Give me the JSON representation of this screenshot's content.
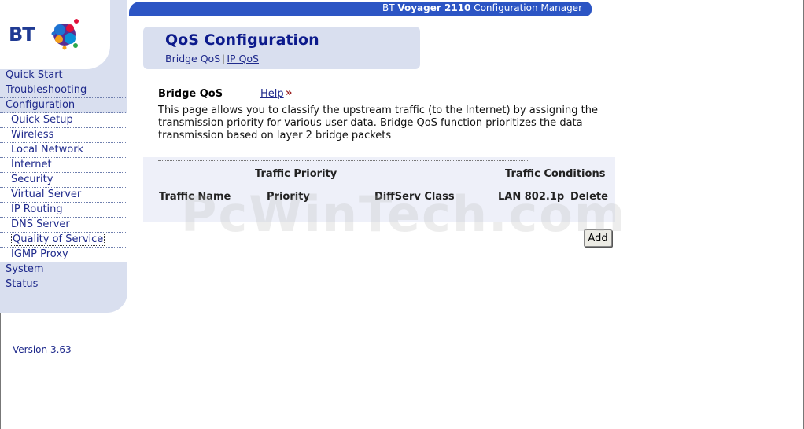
{
  "header": {
    "title_prefix": "BT ",
    "title_bold": "Voyager 2110",
    "title_suffix": " Configuration Manager"
  },
  "logo": {
    "text": "BT"
  },
  "sidebar": {
    "items": [
      {
        "label": "Quick Start",
        "level": "top"
      },
      {
        "label": "Troubleshooting",
        "level": "top"
      },
      {
        "label": "Configuration",
        "level": "top"
      },
      {
        "label": "Quick Setup",
        "level": "sub"
      },
      {
        "label": "Wireless",
        "level": "sub"
      },
      {
        "label": "Local Network",
        "level": "sub"
      },
      {
        "label": "Internet",
        "level": "sub"
      },
      {
        "label": "Security",
        "level": "sub"
      },
      {
        "label": "Virtual Server",
        "level": "sub"
      },
      {
        "label": "IP Routing",
        "level": "sub"
      },
      {
        "label": "DNS Server",
        "level": "sub"
      },
      {
        "label": "Quality of Service",
        "level": "sub",
        "active": true
      },
      {
        "label": "IGMP Proxy",
        "level": "sub"
      },
      {
        "label": "System",
        "level": "top"
      },
      {
        "label": "Status",
        "level": "top"
      }
    ],
    "version": "Version 3.63"
  },
  "page": {
    "title": "QoS Configuration",
    "subnav": {
      "current": "Bridge QoS",
      "separator": "|",
      "link": "IP QoS"
    },
    "section_heading": "Bridge QoS",
    "help_label": "Help",
    "help_icon": "»",
    "description": "This page allows you to classify the upstream traffic (to the Internet) by assigning the transmission priority for various user data. Bridge QoS function prioritizes the data transmission based on layer 2 bridge packets"
  },
  "table": {
    "group_headers": {
      "priority": "Traffic Priority",
      "conditions": "Traffic Conditions"
    },
    "columns": [
      "Traffic Name",
      "Priority",
      "DiffServ Class",
      "LAN 802.1p",
      "Delete"
    ]
  },
  "buttons": {
    "add": "Add"
  },
  "watermark": "PcWinTech.com",
  "colors": {
    "header_bar": "#2c55c4",
    "sidebar_bg": "#d9dfef",
    "link": "#1f2a8c",
    "title": "#0c1a8c"
  }
}
